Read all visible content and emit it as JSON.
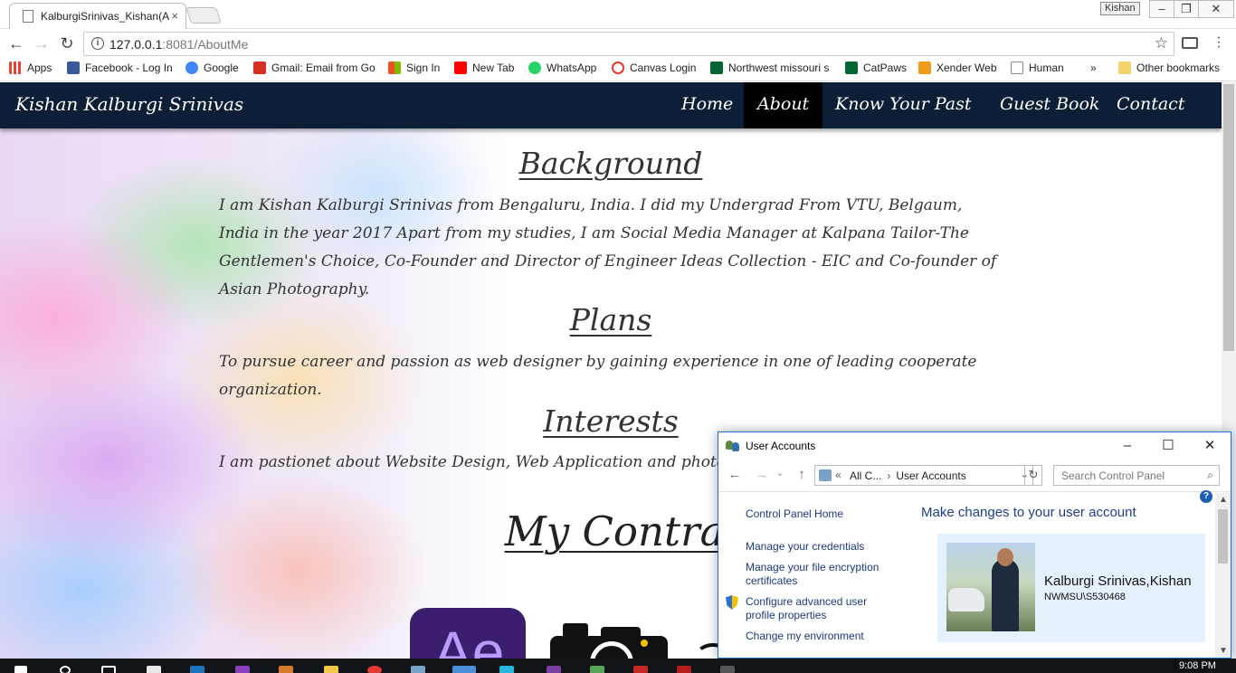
{
  "browser": {
    "tab_title": "KalburgiSrinivas_Kishan(A",
    "tab_close": "×",
    "profile_label": "Kishan",
    "url_host": "127.0.0.1",
    "url_rest": ":8081/AboutMe",
    "bookmarks": [
      {
        "label": "Apps",
        "color": "#e94235"
      },
      {
        "label": "Facebook - Log In",
        "color": "#3b5998"
      },
      {
        "label": "Google",
        "color": "#4285f4"
      },
      {
        "label": "Gmail: Email from Go",
        "color": "#d93025"
      },
      {
        "label": "Sign In",
        "color": "#f2a400"
      },
      {
        "label": "New Tab",
        "color": "#ff0000"
      },
      {
        "label": "WhatsApp",
        "color": "#25d366"
      },
      {
        "label": "Canvas Login",
        "color": "#e4382b"
      },
      {
        "label": "Northwest missouri s",
        "color": "#006633"
      },
      {
        "label": "CatPaws",
        "color": "#006633"
      },
      {
        "label": "Xender Web",
        "color": "#f09b1a"
      },
      {
        "label": "Human",
        "color": "#888888"
      }
    ],
    "bookmarks_overflow": "»",
    "other_bookmarks": "Other bookmarks"
  },
  "site": {
    "brand": "Kishan Kalburgi Srinivas",
    "nav": [
      "Home",
      "About",
      "Know Your Past",
      "Guest Book",
      "Contact"
    ],
    "active_nav": "About",
    "sections": {
      "background_title": "Background",
      "background_text": "I am Kishan Kalburgi Srinivas from Bengaluru, India. I did my Undergrad From VTU, Belgaum, India in the year 2017 Apart from my studies, I am Social Media Manager at Kalpana Tailor-The Gentlemen's Choice, Co-Founder and Director of Engineer Ideas Collection - EIC and Co-founder of Asian Photography.",
      "plans_title": "Plans",
      "plans_text": "To pursue career and passion as web designer by gaining experience in one of leading cooperate organization.",
      "interests_title": "Interests",
      "interests_text": "I am pastionet about Website Design, Web Application and photograp",
      "contraption_title": "My Contrapt"
    },
    "logo_text": "Ae"
  },
  "user_accounts": {
    "window_title": "User Accounts",
    "path_parent": "All C...",
    "path_current": "User Accounts",
    "search_placeholder": "Search Control Panel",
    "links": [
      "Control Panel Home",
      "Manage your credentials",
      "Manage your file encryption certificates",
      "Configure advanced user profile properties",
      "Change my environment"
    ],
    "heading": "Make changes to your user account",
    "account_name": "Kalburgi Srinivas,Kishan",
    "account_domain": "NWMSU\\S530468"
  },
  "taskbar": {
    "clock": "9:08 PM"
  }
}
